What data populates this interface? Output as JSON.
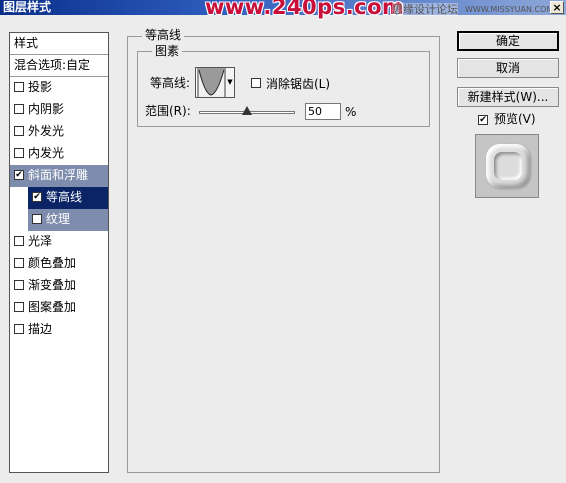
{
  "window": {
    "title": "图层样式",
    "watermark": "www.240ps.com",
    "watermark2": "思缘设计论坛",
    "watermark3": "WWW.MISSYUAN.COM",
    "close_glyph": "×"
  },
  "sidebar": {
    "header": "样式",
    "blend_options": "混合选项:自定",
    "items": [
      {
        "label": "投影",
        "checked": false
      },
      {
        "label": "内阴影",
        "checked": false
      },
      {
        "label": "外发光",
        "checked": false
      },
      {
        "label": "内发光",
        "checked": false
      },
      {
        "label": "斜面和浮雕",
        "checked": true
      },
      {
        "label": "等高线",
        "checked": true
      },
      {
        "label": "纹理",
        "checked": false
      },
      {
        "label": "光泽",
        "checked": false
      },
      {
        "label": "颜色叠加",
        "checked": false
      },
      {
        "label": "渐变叠加",
        "checked": false
      },
      {
        "label": "图案叠加",
        "checked": false
      },
      {
        "label": "描边",
        "checked": false
      }
    ]
  },
  "contour_panel": {
    "group_title": "等高线",
    "subgroup_title": "图素",
    "contour_label": "等高线:",
    "antialias_label": "消除锯齿(L)",
    "antialias_checked": false,
    "range_label": "范围(R):",
    "range_value": "50",
    "range_unit": "%",
    "range_level_percent": 50
  },
  "buttons": {
    "ok": "确定",
    "cancel": "取消",
    "new_style": "新建样式(W)...",
    "preview_label": "预览(V)",
    "preview_checked": true
  },
  "colors": {
    "selected_bevel": "#7e8dae",
    "selected_contour": "#0a2466",
    "watermark": "#c8103a"
  }
}
